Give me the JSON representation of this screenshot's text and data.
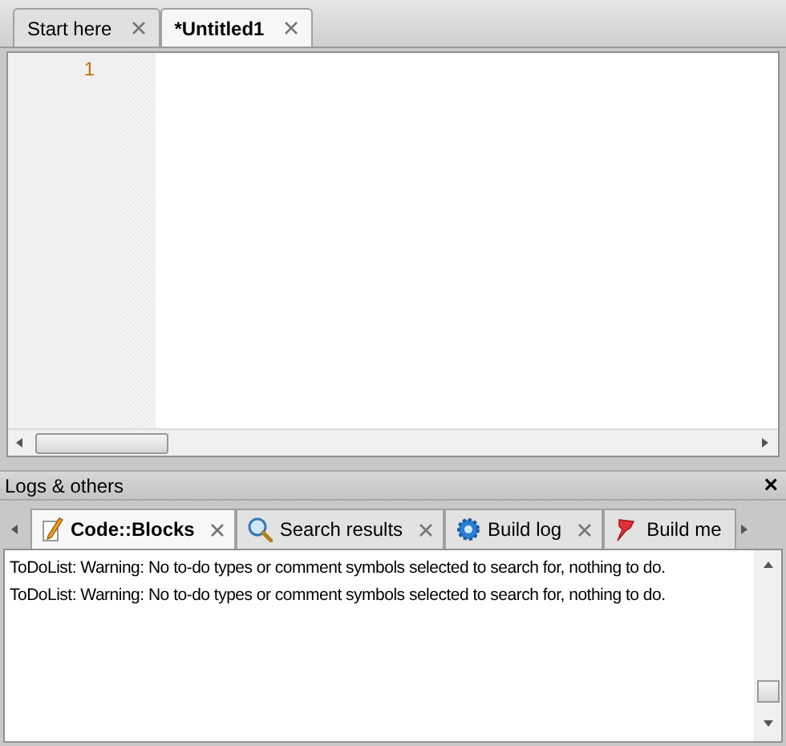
{
  "editor_tabs": [
    {
      "label": "Start here",
      "selected": false
    },
    {
      "label": "*Untitled1",
      "selected": true
    }
  ],
  "editor": {
    "line_numbers": [
      "1"
    ]
  },
  "logs_panel": {
    "title": "Logs & others",
    "close": "×",
    "tabs": [
      {
        "label": "Code::Blocks",
        "kind": "pencil",
        "selected": true,
        "closable": true
      },
      {
        "label": "Search results",
        "kind": "search",
        "selected": false,
        "closable": true
      },
      {
        "label": "Build log",
        "kind": "gear",
        "selected": false,
        "closable": true
      },
      {
        "label": "Build me",
        "kind": "pin",
        "selected": false,
        "closable": false
      }
    ],
    "messages": [
      "ToDoList: Warning: No to-do types or comment symbols selected to search for, nothing to do.",
      "ToDoList: Warning: No to-do types or comment symbols selected to search for, nothing to do."
    ]
  }
}
